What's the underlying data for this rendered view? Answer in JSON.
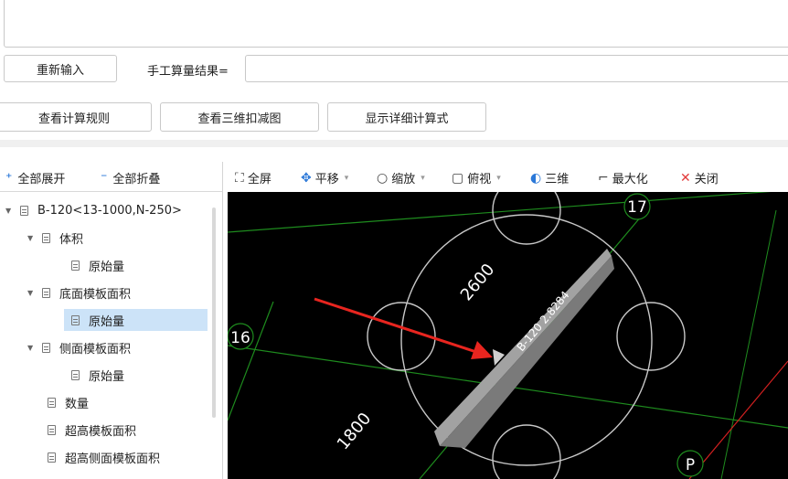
{
  "top": {
    "reinput_label": "重新输入",
    "manual_result_label": "手工算量结果=",
    "manual_result_value": ""
  },
  "actions": {
    "view_rules": "查看计算规则",
    "view_3d": "查看三维扣减图",
    "show_formula": "显示详细计算式"
  },
  "tree_toolbar": {
    "expand_all": "全部展开",
    "collapse_all": "全部折叠"
  },
  "tree": [
    {
      "label": "B-120<13-1000,N-250>",
      "level": 0,
      "expanded": true,
      "selected": false
    },
    {
      "label": "体积",
      "level": 1,
      "expanded": true,
      "selected": false
    },
    {
      "label": "原始量",
      "level": 2,
      "selected": false
    },
    {
      "label": "底面模板面积",
      "level": 1,
      "expanded": true,
      "selected": false
    },
    {
      "label": "原始量",
      "level": 2,
      "selected": true
    },
    {
      "label": "侧面模板面积",
      "level": 1,
      "expanded": true,
      "selected": false
    },
    {
      "label": "原始量",
      "level": 2,
      "selected": false
    },
    {
      "label": "数量",
      "level": 1,
      "selected": false
    },
    {
      "label": "超高模板面积",
      "level": 1,
      "selected": false
    },
    {
      "label": "超高侧面模板面积",
      "level": 1,
      "selected": false
    }
  ],
  "view_toolbar": {
    "fullscreen": "全屏",
    "pan": "平移",
    "zoom": "缩放",
    "top_view": "俯视",
    "three_d": "三维",
    "maximize": "最大化",
    "close": "关闭"
  },
  "drawing": {
    "axis_17": "17",
    "axis_16": "16",
    "axis_p": "P",
    "dim_2600": "2600",
    "dim_1800": "1800",
    "slab_label": "B-120 2.8284",
    "colors": {
      "grid_line": "#1e8c1e",
      "axis_red": "#d42020",
      "arrow": "#e8251f",
      "slab": "#9a9a9a",
      "circle": "#c8c8c8"
    }
  }
}
